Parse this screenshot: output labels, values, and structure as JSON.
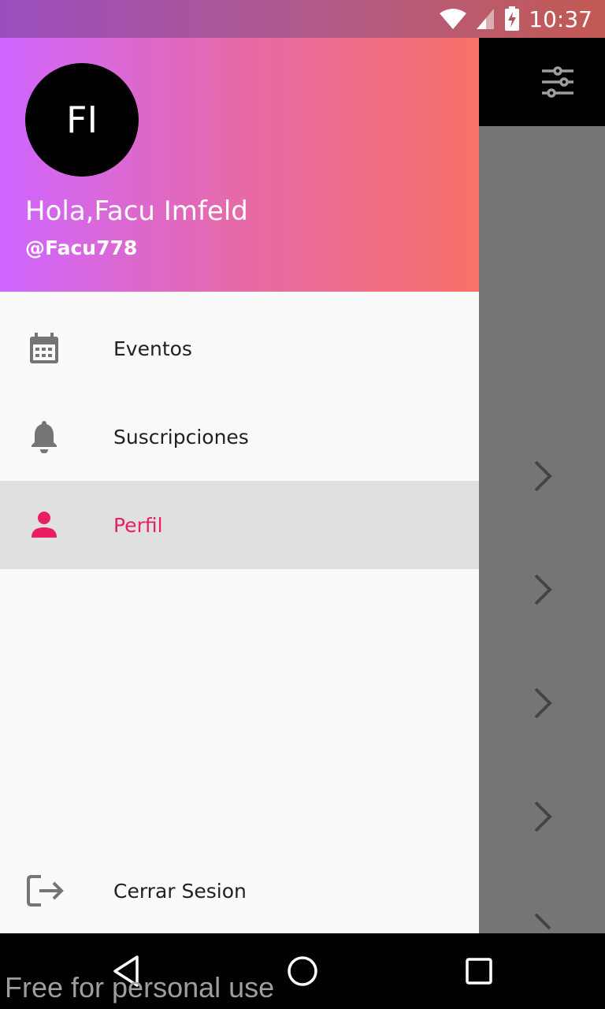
{
  "status_bar": {
    "time": "10:37",
    "icons": [
      "wifi-icon",
      "signal-icon",
      "battery-charging-icon"
    ]
  },
  "toolbar": {
    "icon": "filter-sliders-icon"
  },
  "drawer": {
    "header": {
      "avatar_initials": "FI",
      "greeting": "Hola,Facu Imfeld",
      "username": "@Facu778",
      "gradient": [
        "#cf66ff",
        "#f87168"
      ]
    },
    "items": [
      {
        "label": "Eventos",
        "icon": "calendar-icon"
      },
      {
        "label": "Suscripciones",
        "icon": "bell-icon"
      },
      {
        "label": "Perfil",
        "icon": "person-icon",
        "selected": true
      },
      {
        "label": "Cerrar Sesion",
        "icon": "logout-icon"
      }
    ],
    "accent_color": "#e91e63"
  },
  "nav_bar": {
    "buttons": [
      "back-icon",
      "home-icon",
      "recents-icon"
    ]
  },
  "watermark": "Free for personal use"
}
